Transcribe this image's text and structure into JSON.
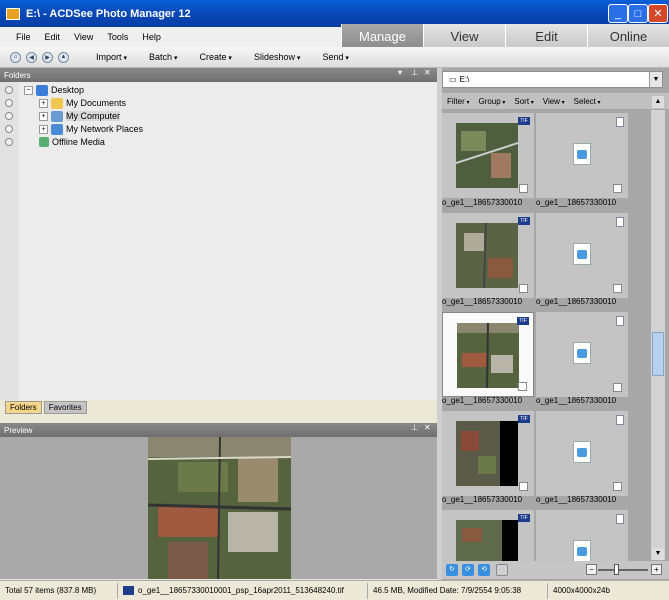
{
  "window": {
    "title": "E:\\ - ACDSee Photo Manager 12",
    "minimize": "_",
    "maximize": "□",
    "close": "✕"
  },
  "menu": [
    "File",
    "Edit",
    "View",
    "Tools",
    "Help"
  ],
  "modes": [
    "Manage",
    "View",
    "Edit",
    "Online"
  ],
  "toolbar": {
    "nav": [
      "⌂",
      "◀",
      "▶",
      "▲"
    ],
    "items": [
      "Import",
      "Batch",
      "Create",
      "Slideshow",
      "Send"
    ]
  },
  "folders_panel": {
    "title": "Folders",
    "tree": [
      {
        "label": "Desktop",
        "expander": "−"
      },
      {
        "label": "My Documents",
        "expander": "+"
      },
      {
        "label": "My Computer",
        "expander": "+"
      },
      {
        "label": "My Network Places",
        "expander": "+"
      },
      {
        "label": "Offline Media",
        "expander": ""
      }
    ],
    "tabs": [
      "Folders",
      "Favorites"
    ]
  },
  "preview_panel": {
    "title": "Preview"
  },
  "browser": {
    "path": "E:\\",
    "filters": [
      "Filter",
      "Group",
      "Sort",
      "View",
      "Select"
    ],
    "thumbnails": [
      {
        "caption": "o_ge1__18657330010",
        "kind": "tif",
        "badge": "TIF"
      },
      {
        "caption": "o_ge1__18657330010",
        "kind": "doc",
        "badge": ""
      },
      {
        "caption": "o_ge1__18657330010",
        "kind": "tif",
        "badge": "TIF"
      },
      {
        "caption": "o_ge1__18657330010",
        "kind": "doc",
        "badge": ""
      },
      {
        "caption": "o_ge1__18657330010",
        "kind": "tif",
        "badge": "TIF"
      },
      {
        "caption": "o_ge1__18657330010",
        "kind": "doc",
        "badge": ""
      },
      {
        "caption": "o_ge1__18657330010",
        "kind": "tif",
        "badge": "TIF"
      },
      {
        "caption": "o_ge1__18657330010",
        "kind": "doc",
        "badge": ""
      },
      {
        "caption": "",
        "kind": "tif",
        "badge": "TIF"
      },
      {
        "caption": "",
        "kind": "doc",
        "badge": ""
      }
    ],
    "bottom_buttons": [
      "↻",
      "⟳",
      "⟲"
    ]
  },
  "status": {
    "total": "Total 57 items  (837.8 MB)",
    "file": "o_ge1__18657330010001_psp_16apr2011_513648240.tif",
    "details": "46.5 MB, Modified Date: 7/9/2554 9:05:38",
    "dimensions": "4000x4000x24b"
  }
}
